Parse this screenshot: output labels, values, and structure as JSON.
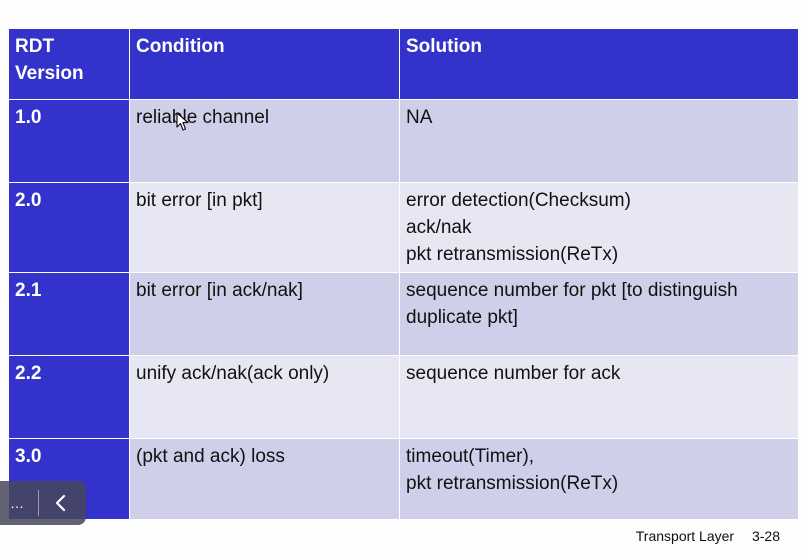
{
  "table": {
    "headers": [
      "RDT\nVersion",
      "Condition",
      "Solution"
    ],
    "header_lines": [
      [
        "RDT",
        "Version"
      ],
      [
        "Condition"
      ],
      [
        "Solution"
      ]
    ],
    "rows": [
      {
        "version": "1.0",
        "condition": "reliable channel",
        "solution": [
          "NA"
        ]
      },
      {
        "version": "2.0",
        "condition": "bit error [in pkt]",
        "solution": [
          "error detection(Checksum)",
          "ack/nak",
          "pkt retransmission(ReTx)"
        ]
      },
      {
        "version": "2.1",
        "condition": "bit error [in ack/nak]",
        "solution": [
          "sequence number for pkt [to distinguish",
          "duplicate pkt]"
        ]
      },
      {
        "version": "2.2",
        "condition": "unify ack/nak(ack only)",
        "solution": [
          "sequence number for ack"
        ]
      },
      {
        "version": "3.0",
        "condition": "(pkt and ack) loss",
        "solution": [
          "timeout(Timer),",
          "pkt retransmission(ReTx)"
        ]
      }
    ]
  },
  "footer": {
    "section": "Transport Layer",
    "page": "3-28"
  },
  "nav": {
    "menu_icon": "ellipsis-menu-icon",
    "back_icon": "chevron-left-icon",
    "menu_text": "…"
  },
  "colors": {
    "header_bg": "#3333cc",
    "row_odd": "#cfcfe9",
    "row_even": "#e7e7f3"
  }
}
